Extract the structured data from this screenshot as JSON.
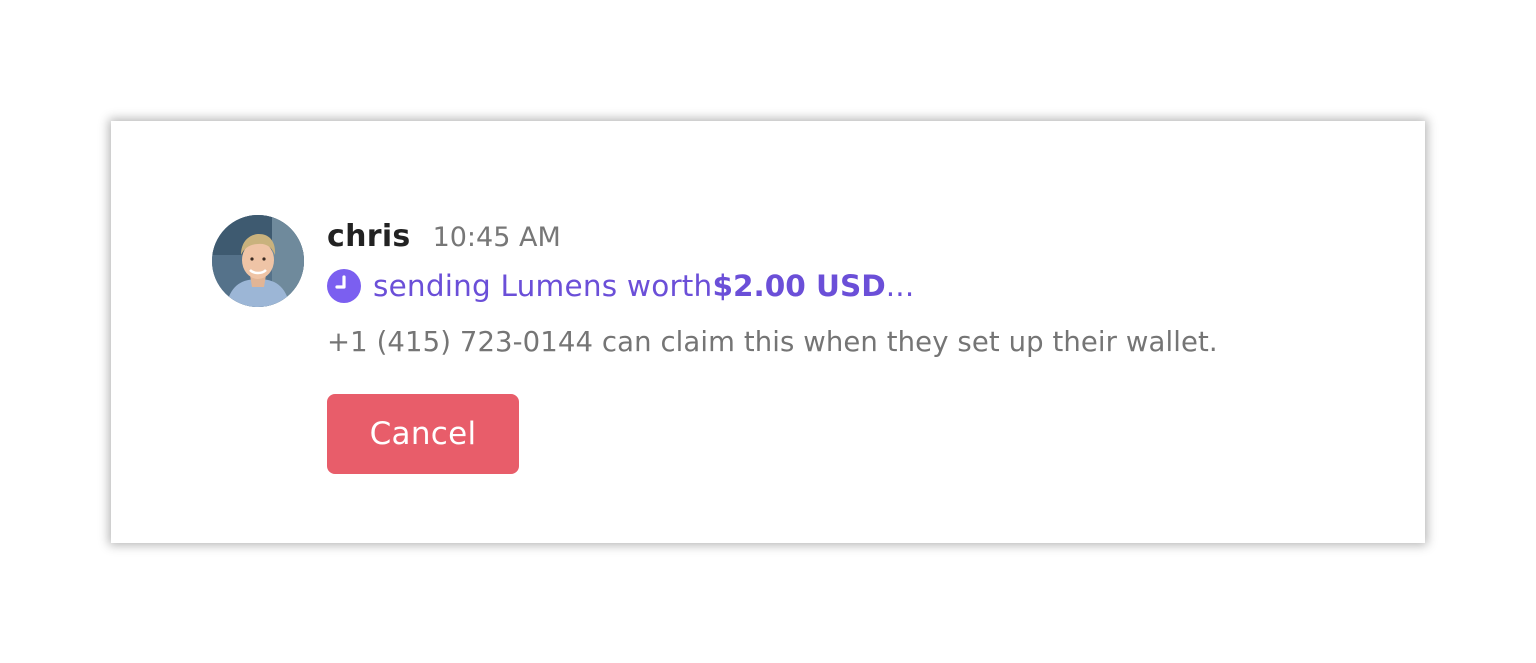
{
  "message": {
    "username": "chris",
    "timestamp": "10:45 AM",
    "status": {
      "icon": "clock-icon",
      "prefix": "sending Lumens worth ",
      "amount": "$2.00 USD",
      "suffix": "...",
      "color": "#6b4fd8"
    },
    "note": "+1 (415) 723-0144 can claim this when they set up their wallet."
  },
  "actions": {
    "cancel_label": "Cancel",
    "cancel_color": "#e85d6a"
  }
}
